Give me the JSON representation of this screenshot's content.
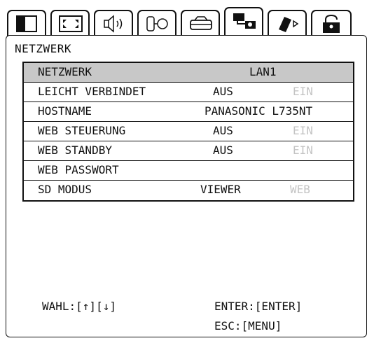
{
  "tabs": [
    {
      "icon": "picture-icon"
    },
    {
      "icon": "position-icon"
    },
    {
      "icon": "audio-icon"
    },
    {
      "icon": "advanced-menu-icon"
    },
    {
      "icon": "projector-setup-icon"
    },
    {
      "icon": "network-icon",
      "active": true
    },
    {
      "icon": "memory-viewer-icon"
    },
    {
      "icon": "security-icon"
    }
  ],
  "panel": {
    "title": "NETZWERK"
  },
  "menu": {
    "rows": [
      {
        "label": "NETZWERK",
        "value": "LAN1"
      },
      {
        "label": "LEICHT VERBINDET",
        "value": "AUS",
        "alt": "EIN"
      },
      {
        "label": "HOSTNAME",
        "value": "PANASONIC L735NT"
      },
      {
        "label": "WEB STEUERUNG",
        "value": "AUS",
        "alt": "EIN"
      },
      {
        "label": "WEB STANDBY",
        "value": "AUS",
        "alt": "EIN"
      },
      {
        "label": "WEB PASSWORT",
        "value": ""
      },
      {
        "label": "SD MODUS",
        "value": "VIEWER",
        "alt": "WEB"
      }
    ]
  },
  "footer": {
    "select_hint": "WAHL:[↑][↓]",
    "enter_hint": "ENTER:[ENTER]",
    "esc_hint": "ESC:[MENU]"
  }
}
